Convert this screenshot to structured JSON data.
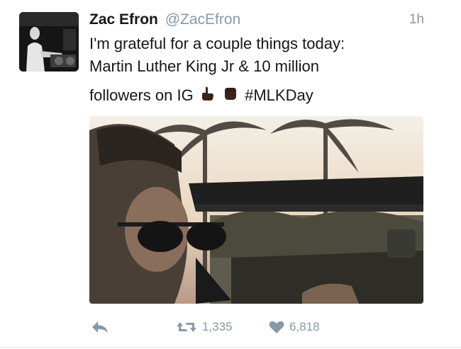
{
  "tweet": {
    "author_name": "Zac Efron",
    "author_handle": "@ZacEfron",
    "timestamp": "1h",
    "text_lines": [
      "I'm grateful for a couple things today:",
      "Martin Luther King Jr & 10 million",
      "followers on IG"
    ],
    "hashtag": "#MLKDay",
    "emojis": [
      "pointing-hand-emoji",
      "raised-fist-emoji"
    ]
  },
  "actions": {
    "reply_icon": "reply-icon",
    "retweet_count": "1,335",
    "like_count": "6,818"
  },
  "colors": {
    "text": "#14171a",
    "muted": "#8899a6",
    "divider": "#e1e8ed"
  }
}
